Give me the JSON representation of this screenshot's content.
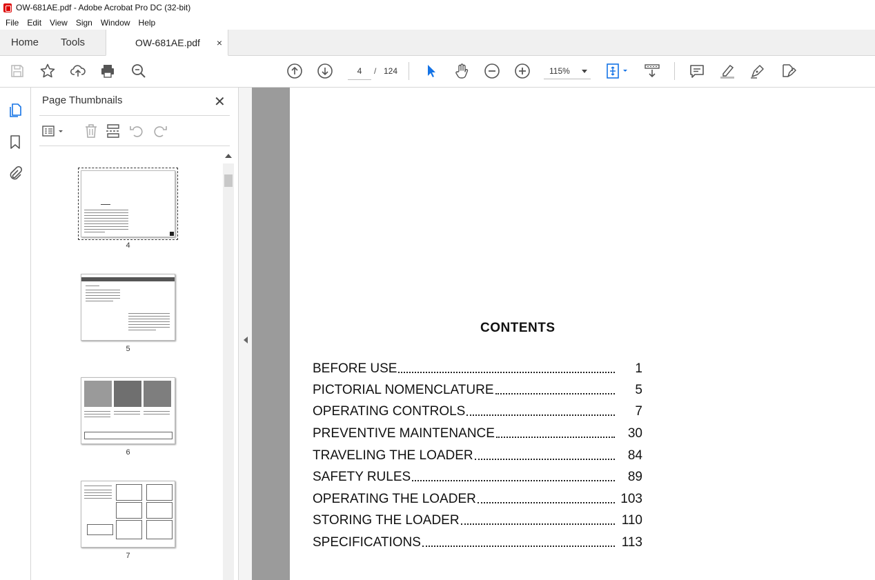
{
  "window": {
    "title": "OW-681AE.pdf - Adobe Acrobat Pro DC (32-bit)"
  },
  "menu": [
    "File",
    "Edit",
    "View",
    "Sign",
    "Window",
    "Help"
  ],
  "tabs": {
    "home": "Home",
    "tools": "Tools",
    "document": "OW-681AE.pdf",
    "close": "×"
  },
  "toolbar": {
    "current_page": "4",
    "page_separator": "/",
    "total_pages": "124",
    "zoom": "115%"
  },
  "panel": {
    "title": "Page Thumbnails",
    "close": "✕",
    "thumbnails": [
      {
        "page": "4",
        "selected": true
      },
      {
        "page": "5",
        "selected": false
      },
      {
        "page": "6",
        "selected": false
      },
      {
        "page": "7",
        "selected": false
      }
    ]
  },
  "document": {
    "heading": "CONTENTS",
    "toc": [
      {
        "label": "BEFORE USE",
        "page": "1"
      },
      {
        "label": "PICTORIAL NOMENCLATURE",
        "page": "5"
      },
      {
        "label": "OPERATING CONTROLS",
        "page": "7"
      },
      {
        "label": "PREVENTIVE MAINTENANCE",
        "page": "30"
      },
      {
        "label": "TRAVELING THE LOADER",
        "page": "84"
      },
      {
        "label": "SAFETY RULES",
        "page": "89"
      },
      {
        "label": "OPERATING THE LOADER",
        "page": "103"
      },
      {
        "label": "STORING THE LOADER",
        "page": "110"
      },
      {
        "label": "SPECIFICATIONS",
        "page": "113"
      }
    ]
  },
  "colors": {
    "select_tool": "#1473e6",
    "doc_background": "#9b9b9b"
  }
}
